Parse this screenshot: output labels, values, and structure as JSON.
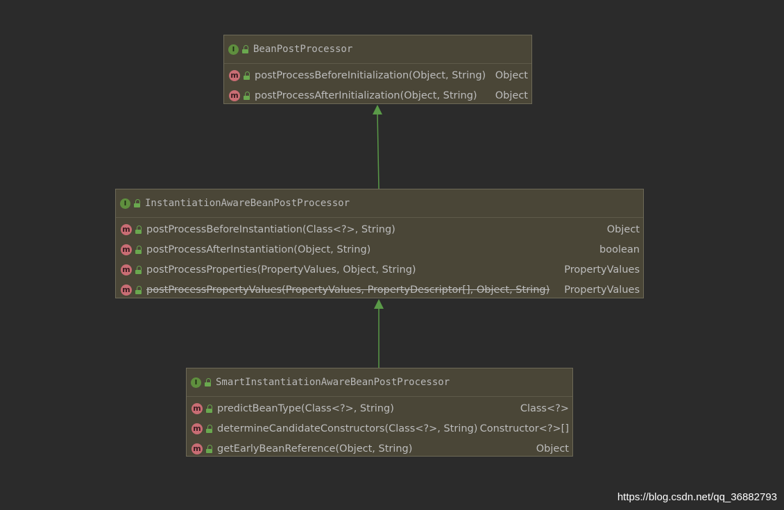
{
  "colors": {
    "background": "#2b2b2b",
    "box_fill": "#4a4637",
    "arrow": "#5a9a48",
    "interface_icon": "#5f8f3e",
    "method_icon": "#c96d74",
    "text": "#bdbdbd"
  },
  "boxes": [
    {
      "id": "bean-post-processor",
      "kind_icon": "I",
      "title": "BeanPostProcessor",
      "methods": [
        {
          "icon": "m",
          "signature": "postProcessBeforeInitialization(Object, String)",
          "returns": "Object",
          "deprecated": false
        },
        {
          "icon": "m",
          "signature": "postProcessAfterInitialization(Object, String)",
          "returns": "Object",
          "deprecated": false
        }
      ]
    },
    {
      "id": "instantiation-aware-bean-post-processor",
      "kind_icon": "I",
      "title": "InstantiationAwareBeanPostProcessor",
      "methods": [
        {
          "icon": "m",
          "signature": "postProcessBeforeInstantiation(Class<?>, String)",
          "returns": "Object",
          "deprecated": false
        },
        {
          "icon": "m",
          "signature": "postProcessAfterInstantiation(Object, String)",
          "returns": "boolean",
          "deprecated": false
        },
        {
          "icon": "m",
          "signature": "postProcessProperties(PropertyValues, Object, String)",
          "returns": "PropertyValues",
          "deprecated": false
        },
        {
          "icon": "m",
          "signature": "postProcessPropertyValues(PropertyValues, PropertyDescriptor[], Object, String)",
          "returns": "PropertyValues",
          "deprecated": true
        }
      ]
    },
    {
      "id": "smart-instantiation-aware-bean-post-processor",
      "kind_icon": "I",
      "title": "SmartInstantiationAwareBeanPostProcessor",
      "methods": [
        {
          "icon": "m",
          "signature": "predictBeanType(Class<?>, String)",
          "returns": "Class<?>",
          "deprecated": false
        },
        {
          "icon": "m",
          "signature": "determineCandidateConstructors(Class<?>, String)",
          "returns": "Constructor<?>[]",
          "deprecated": false
        },
        {
          "icon": "m",
          "signature": "getEarlyBeanReference(Object, String)",
          "returns": "Object",
          "deprecated": false
        }
      ]
    }
  ],
  "edges": [
    {
      "from": "instantiation-aware-bean-post-processor",
      "to": "bean-post-processor",
      "type": "extends"
    },
    {
      "from": "smart-instantiation-aware-bean-post-processor",
      "to": "instantiation-aware-bean-post-processor",
      "type": "extends"
    }
  ],
  "watermark": "https://blog.csdn.net/qq_36882793"
}
